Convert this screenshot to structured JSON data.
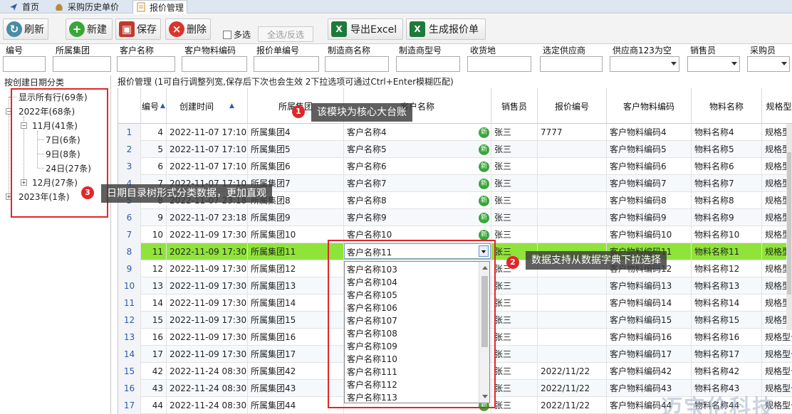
{
  "tabs": [
    {
      "label": "首页",
      "icon": "home-arrow-icon"
    },
    {
      "label": "采购历史单价",
      "icon": "money-bag-icon"
    },
    {
      "label": "报价管理",
      "icon": "document-icon",
      "active": true
    }
  ],
  "toolbar": {
    "refresh": "刷新",
    "new": "新建",
    "save": "保存",
    "delete": "删除",
    "multi_select": "多选",
    "select_all": "全选/反选",
    "export_excel": "导出Excel",
    "generate_quote": "生成报价单"
  },
  "filters": [
    "编号",
    "所属集团",
    "客户名称",
    "客户物料编码",
    "报价单编号",
    "制造商名称",
    "制造商型号",
    "收货地",
    "选定供应商",
    "供应商123为空",
    "销售员",
    "采购员"
  ],
  "tree": {
    "title": "按创建日期分类",
    "show_all": "显示所有行(69条)",
    "y2022": "2022年(68条)",
    "nov": "11月(41条)",
    "d7": "7日(6条)",
    "d9": "9日(8条)",
    "d24": "24日(27条)",
    "dec": "12月(27条)",
    "y2023": "2023年(1条)"
  },
  "grid": {
    "title": "报价管理 (1可自行调整列宽,保存后下次也会生效 2下拉选项可通过Ctrl+Enter模糊匹配)",
    "columns": [
      "编号",
      "创建时间",
      "所属集团",
      "客户名称",
      "销售员",
      "报价编号",
      "客户物料编码",
      "物料名称",
      "规格型号"
    ],
    "rows": [
      {
        "rn": "1",
        "id": "4",
        "time": "2022-11-07 17:10",
        "group": "所属集团4",
        "customer": "客户名称4",
        "sales": "张三",
        "quote": "7777",
        "code": "客户物料编码4",
        "material": "物料名称4",
        "spec": "规格型号"
      },
      {
        "rn": "2",
        "id": "5",
        "time": "2022-11-07 17:10",
        "group": "所属集团5",
        "customer": "客户名称5",
        "sales": "张三",
        "quote": "",
        "code": "客户物料编码5",
        "material": "物料名称5",
        "spec": "规格型号"
      },
      {
        "rn": "3",
        "id": "6",
        "time": "2022-11-07 17:10",
        "group": "所属集团6",
        "customer": "客户名称6",
        "sales": "张三",
        "quote": "",
        "code": "客户物料编码6",
        "material": "物料名称6",
        "spec": "规格型号"
      },
      {
        "rn": "4",
        "id": "7",
        "time": "2022-11-07 17:10",
        "group": "所属集团7",
        "customer": "客户名称7",
        "sales": "张三",
        "quote": "",
        "code": "客户物料编码7",
        "material": "物料名称7",
        "spec": "规格型号"
      },
      {
        "rn": "5",
        "id": "8",
        "time": "2022-11-07 23:18",
        "group": "所属集团8",
        "customer": "客户名称8",
        "sales": "张三",
        "quote": "",
        "code": "客户物料编码8",
        "material": "物料名称8",
        "spec": "规格型号"
      },
      {
        "rn": "6",
        "id": "9",
        "time": "2022-11-07 23:18",
        "group": "所属集团9",
        "customer": "客户名称9",
        "sales": "张三",
        "quote": "",
        "code": "客户物料编码9",
        "material": "物料名称9",
        "spec": "规格型号"
      },
      {
        "rn": "7",
        "id": "10",
        "time": "2022-11-09 17:30",
        "group": "所属集团10",
        "customer": "客户名称10",
        "sales": "张三",
        "quote": "",
        "code": "客户物料编码10",
        "material": "物料名称10",
        "spec": "规格型号"
      },
      {
        "rn": "8",
        "id": "11",
        "time": "2022-11-09 17:30",
        "group": "所属集团11",
        "customer": "客户名称11",
        "sales": "张三",
        "quote": "",
        "code": "客户物料编码11",
        "material": "物料名称11",
        "spec": "规格型号",
        "selected": true
      },
      {
        "rn": "9",
        "id": "12",
        "time": "2022-11-09 17:30",
        "group": "所属集团12",
        "customer": "",
        "sales": "张三",
        "quote": "",
        "code": "客户物料编码12",
        "material": "物料名称12",
        "spec": "规格型号"
      },
      {
        "rn": "10",
        "id": "13",
        "time": "2022-11-09 17:30",
        "group": "所属集团13",
        "customer": "",
        "sales": "张三",
        "quote": "",
        "code": "客户物料编码13",
        "material": "物料名称13",
        "spec": "规格型号"
      },
      {
        "rn": "11",
        "id": "14",
        "time": "2022-11-09 17:30",
        "group": "所属集团14",
        "customer": "",
        "sales": "张三",
        "quote": "",
        "code": "客户物料编码14",
        "material": "物料名称14",
        "spec": "规格型号"
      },
      {
        "rn": "12",
        "id": "15",
        "time": "2022-11-09 17:30",
        "group": "所属集团15",
        "customer": "",
        "sales": "张三",
        "quote": "",
        "code": "客户物料编码15",
        "material": "物料名称15",
        "spec": "规格型号"
      },
      {
        "rn": "13",
        "id": "16",
        "time": "2022-11-09 17:30",
        "group": "所属集团16",
        "customer": "",
        "sales": "张三",
        "quote": "",
        "code": "客户物料编码16",
        "material": "物料名称16",
        "spec": "规格型号"
      },
      {
        "rn": "14",
        "id": "17",
        "time": "2022-11-09 17:30",
        "group": "所属集团17",
        "customer": "",
        "sales": "张三",
        "quote": "",
        "code": "客户物料编码17",
        "material": "物料名称17",
        "spec": "规格型号"
      },
      {
        "rn": "15",
        "id": "42",
        "time": "2022-11-24 08:30",
        "group": "所属集团42",
        "customer": "",
        "sales": "张三",
        "quote": "2022/11/22",
        "code": "客户物料编码42",
        "material": "物料名称42",
        "spec": "规格型号"
      },
      {
        "rn": "16",
        "id": "43",
        "time": "2022-11-24 08:30",
        "group": "所属集团43",
        "customer": "",
        "sales": "张三",
        "quote": "2022/11/22",
        "code": "客户物料编码43",
        "material": "物料名称43",
        "spec": "规格型号"
      },
      {
        "rn": "17",
        "id": "44",
        "time": "2022-11-24 08:30",
        "group": "所属集团44",
        "customer": "",
        "sales": "张三",
        "quote": "2022/11/22",
        "code": "客户物料编码44",
        "material": "物料名称44",
        "spec": "规格型号"
      }
    ],
    "new_badge": "新"
  },
  "dropdown": {
    "current": "客户名称11",
    "options": [
      "客户名称103",
      "客户名称104",
      "客户名称105",
      "客户名称106",
      "客户名称107",
      "客户名称108",
      "客户名称109",
      "客户名称110",
      "客户名称111",
      "客户名称112",
      "客户名称113"
    ]
  },
  "annotations": {
    "a1_num": "1",
    "a1": "该模块为核心大台账",
    "a2_num": "2",
    "a2": "数据支持从数据字典下拉选择",
    "a3_num": "3",
    "a3": "日期目录树形式分类数据，更加直观"
  },
  "watermark": "迈宝伦科技",
  "colors": {
    "selected_row": "#8fe33a",
    "annotation_red": "#e0262a",
    "excel_green": "#1e7a3c"
  }
}
